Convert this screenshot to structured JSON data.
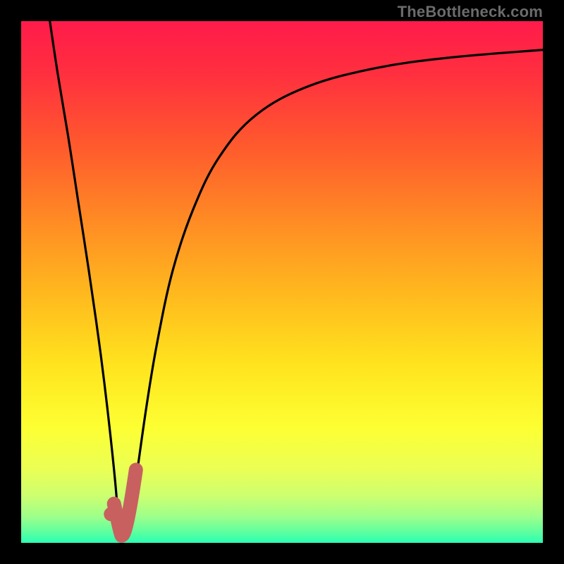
{
  "watermark": "TheBottleneck.com",
  "colors": {
    "background": "#000000",
    "gradient_stops": [
      {
        "offset": 0.0,
        "color": "#ff1b4a"
      },
      {
        "offset": 0.1,
        "color": "#ff2f3f"
      },
      {
        "offset": 0.24,
        "color": "#ff5a2d"
      },
      {
        "offset": 0.38,
        "color": "#ff8a24"
      },
      {
        "offset": 0.52,
        "color": "#ffb81e"
      },
      {
        "offset": 0.66,
        "color": "#ffe41e"
      },
      {
        "offset": 0.78,
        "color": "#fdff33"
      },
      {
        "offset": 0.86,
        "color": "#eaff55"
      },
      {
        "offset": 0.91,
        "color": "#ccff70"
      },
      {
        "offset": 0.95,
        "color": "#9dff8a"
      },
      {
        "offset": 0.98,
        "color": "#5cffa0"
      },
      {
        "offset": 1.0,
        "color": "#2bffb4"
      }
    ],
    "curve": "#000000",
    "marker_stroke": "#c86060",
    "marker_fill": "#c86060"
  },
  "chart_data": {
    "type": "line",
    "title": "",
    "xlabel": "",
    "ylabel": "",
    "xlim": [
      0,
      100
    ],
    "ylim": [
      0,
      100
    ],
    "series": [
      {
        "name": "left-branch",
        "x": [
          5.5,
          7,
          9,
          11,
          13,
          15,
          16.5,
          18,
          18.8
        ],
        "values": [
          100,
          90,
          78,
          65,
          52,
          38,
          26,
          12,
          2
        ]
      },
      {
        "name": "right-branch",
        "x": [
          20.5,
          22,
          24,
          26,
          29,
          33,
          38,
          45,
          55,
          68,
          82,
          100
        ],
        "values": [
          2,
          12,
          26,
          38,
          52,
          64,
          74,
          82,
          87.5,
          91,
          93,
          94.5
        ]
      }
    ],
    "marker": {
      "type": "hook",
      "tip": {
        "x": 17.8,
        "y": 7.5
      },
      "elbow": {
        "x": 19.3,
        "y": 1.5
      },
      "end": {
        "x": 22.0,
        "y": 14.0
      },
      "dot": {
        "x": 17.2,
        "y": 5.5
      }
    }
  }
}
